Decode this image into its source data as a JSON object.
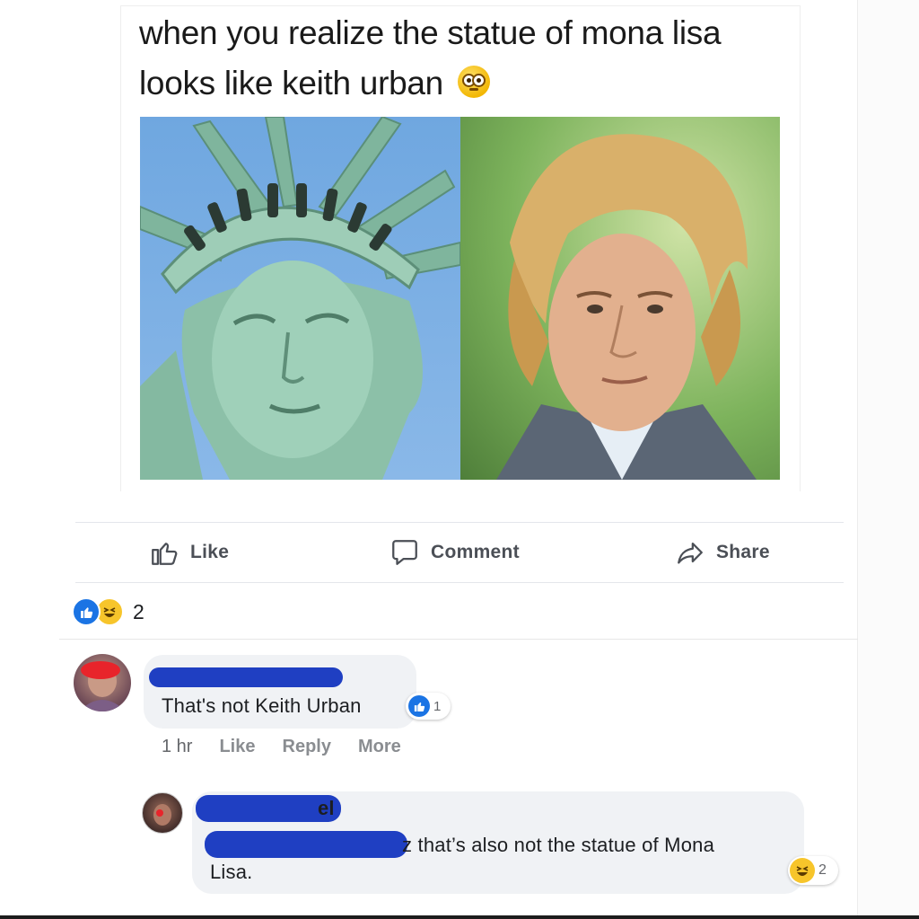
{
  "post": {
    "caption": "when you realize the statue of mona lisa looks like keith urban",
    "emoji": "flushed-face-emoji",
    "images": [
      "statue-of-liberty-photo",
      "man-with-blond-hair-photo"
    ]
  },
  "actions": {
    "like": "Like",
    "comment": "Comment",
    "share": "Share"
  },
  "reactions": {
    "types": [
      "like",
      "haha"
    ],
    "count": "2"
  },
  "comments": [
    {
      "text": "That's not Keith Urban",
      "like_count": "1",
      "meta": {
        "time": "1 hr",
        "like": "Like",
        "reply": "Reply",
        "more": "More"
      }
    },
    {
      "redacted_name_tail": "el",
      "text_line1": "z that’s also not the statue of Mona",
      "text_line2": "Lisa.",
      "haha_count": "2"
    }
  ],
  "colors": {
    "fb_blue": "#1b74e4",
    "bubble_bg": "#f0f2f5",
    "redaction": "#1f3fc2",
    "redaction_red": "#e8242b"
  }
}
